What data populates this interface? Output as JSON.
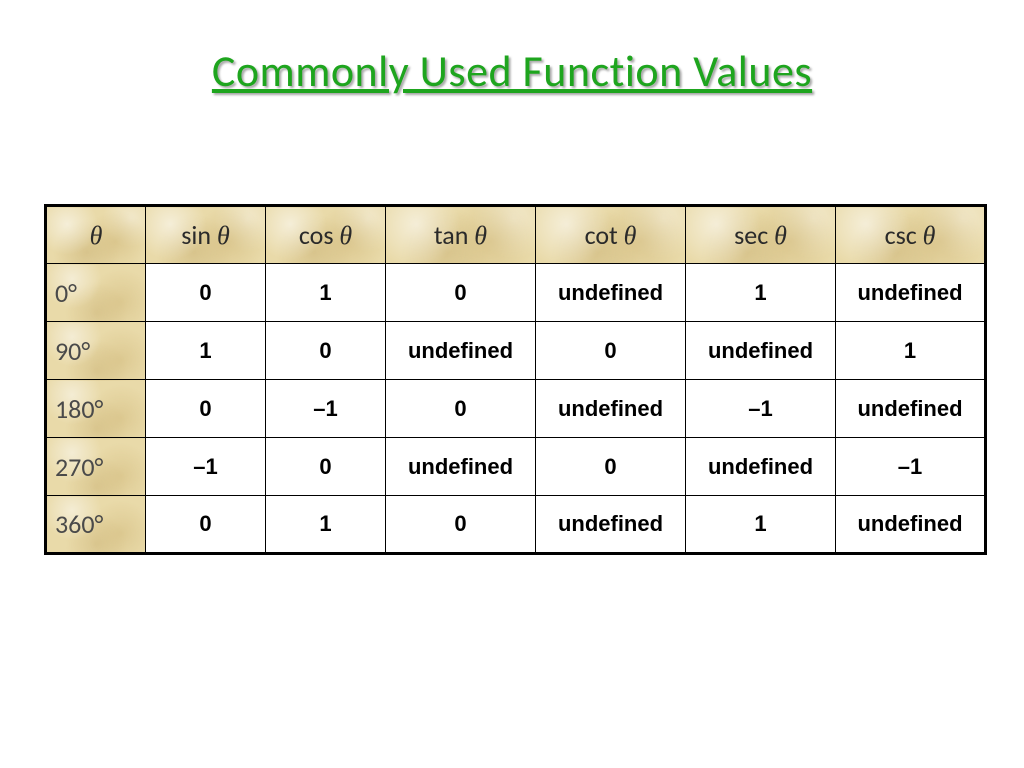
{
  "title": "Commonly Used Function Values",
  "theta_symbol": "θ",
  "headers": {
    "theta": "θ",
    "sin": "sin θ",
    "cos": "cos θ",
    "tan": "tan θ",
    "cot": "cot θ",
    "sec": "sec θ",
    "csc": "csc θ"
  },
  "rows": [
    {
      "angle": "0°",
      "sin": "0",
      "cos": "1",
      "tan": "0",
      "cot": "undefined",
      "sec": "1",
      "csc": "undefined"
    },
    {
      "angle": "90°",
      "sin": "1",
      "cos": "0",
      "tan": "undefined",
      "cot": "0",
      "sec": "undefined",
      "csc": "1"
    },
    {
      "angle": "180°",
      "sin": "0",
      "cos": "–1",
      "tan": "0",
      "cot": "undefined",
      "sec": "–1",
      "csc": "undefined"
    },
    {
      "angle": "270°",
      "sin": "–1",
      "cos": "0",
      "tan": "undefined",
      "cot": "0",
      "sec": "undefined",
      "csc": "–1"
    },
    {
      "angle": "360°",
      "sin": "0",
      "cos": "1",
      "tan": "0",
      "cot": "undefined",
      "sec": "1",
      "csc": "undefined"
    }
  ],
  "chart_data": {
    "type": "table",
    "title": "Commonly Used Function Values",
    "columns": [
      "θ",
      "sin θ",
      "cos θ",
      "tan θ",
      "cot θ",
      "sec θ",
      "csc θ"
    ],
    "rows": [
      [
        "0°",
        "0",
        "1",
        "0",
        "undefined",
        "1",
        "undefined"
      ],
      [
        "90°",
        "1",
        "0",
        "undefined",
        "0",
        "undefined",
        "1"
      ],
      [
        "180°",
        "0",
        "-1",
        "0",
        "undefined",
        "-1",
        "undefined"
      ],
      [
        "270°",
        "-1",
        "0",
        "undefined",
        "0",
        "undefined",
        "-1"
      ],
      [
        "360°",
        "0",
        "1",
        "0",
        "undefined",
        "1",
        "undefined"
      ]
    ]
  }
}
